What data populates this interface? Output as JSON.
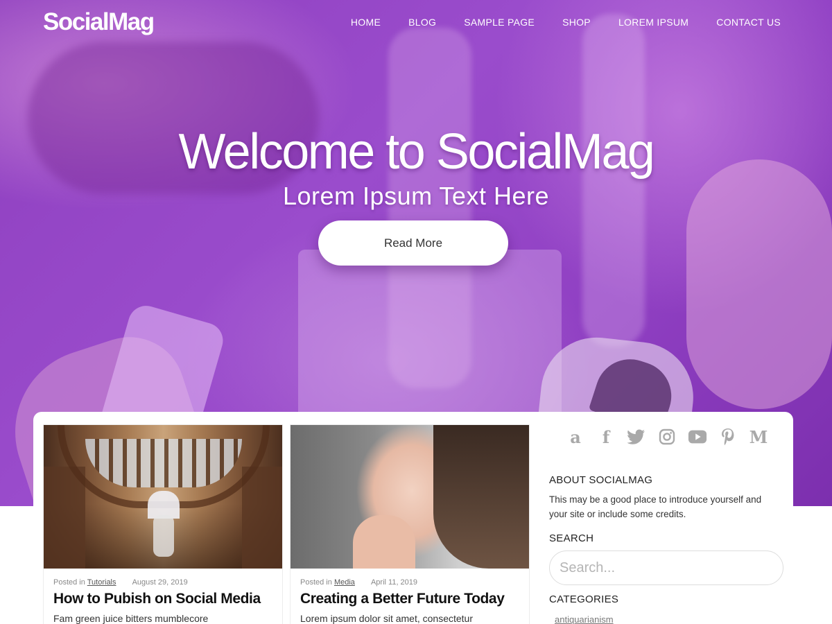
{
  "site": {
    "logo": "SocialMag"
  },
  "nav": {
    "items": [
      {
        "label": "HOME"
      },
      {
        "label": "BLOG"
      },
      {
        "label": "SAMPLE PAGE"
      },
      {
        "label": "SHOP"
      },
      {
        "label": "LOREM IPSUM"
      },
      {
        "label": "CONTACT US"
      }
    ]
  },
  "hero": {
    "title": "Welcome to SocialMag",
    "subtitle": "Lorem Ipsum Text Here",
    "button_label": "Read More"
  },
  "posts": [
    {
      "posted_in_prefix": "Posted in",
      "category": "Tutorials",
      "date": "August 29, 2019",
      "title": "How to Pubish on Social Media",
      "excerpt": "Fam green juice bitters mumblecore"
    },
    {
      "posted_in_prefix": "Posted in",
      "category": "Media",
      "date": "April 11, 2019",
      "title": "Creating a Better Future Today",
      "excerpt": "Lorem ipsum dolor sit amet, consectetur"
    }
  ],
  "sidebar": {
    "social_icons": [
      "amazon-icon",
      "facebook-icon",
      "twitter-icon",
      "instagram-icon",
      "youtube-icon",
      "pinterest-icon",
      "medium-icon"
    ],
    "about": {
      "title": "ABOUT SOCIALMAG",
      "text": "This may be a good place to introduce yourself and your site or include some credits."
    },
    "search": {
      "title": "SEARCH",
      "placeholder": "Search..."
    },
    "categories": {
      "title": "CATEGORIES",
      "first_item": "antiquarianism"
    }
  },
  "colors": {
    "hero_purple": "#8e3fbf",
    "icon_gray": "#a9a9a9"
  }
}
